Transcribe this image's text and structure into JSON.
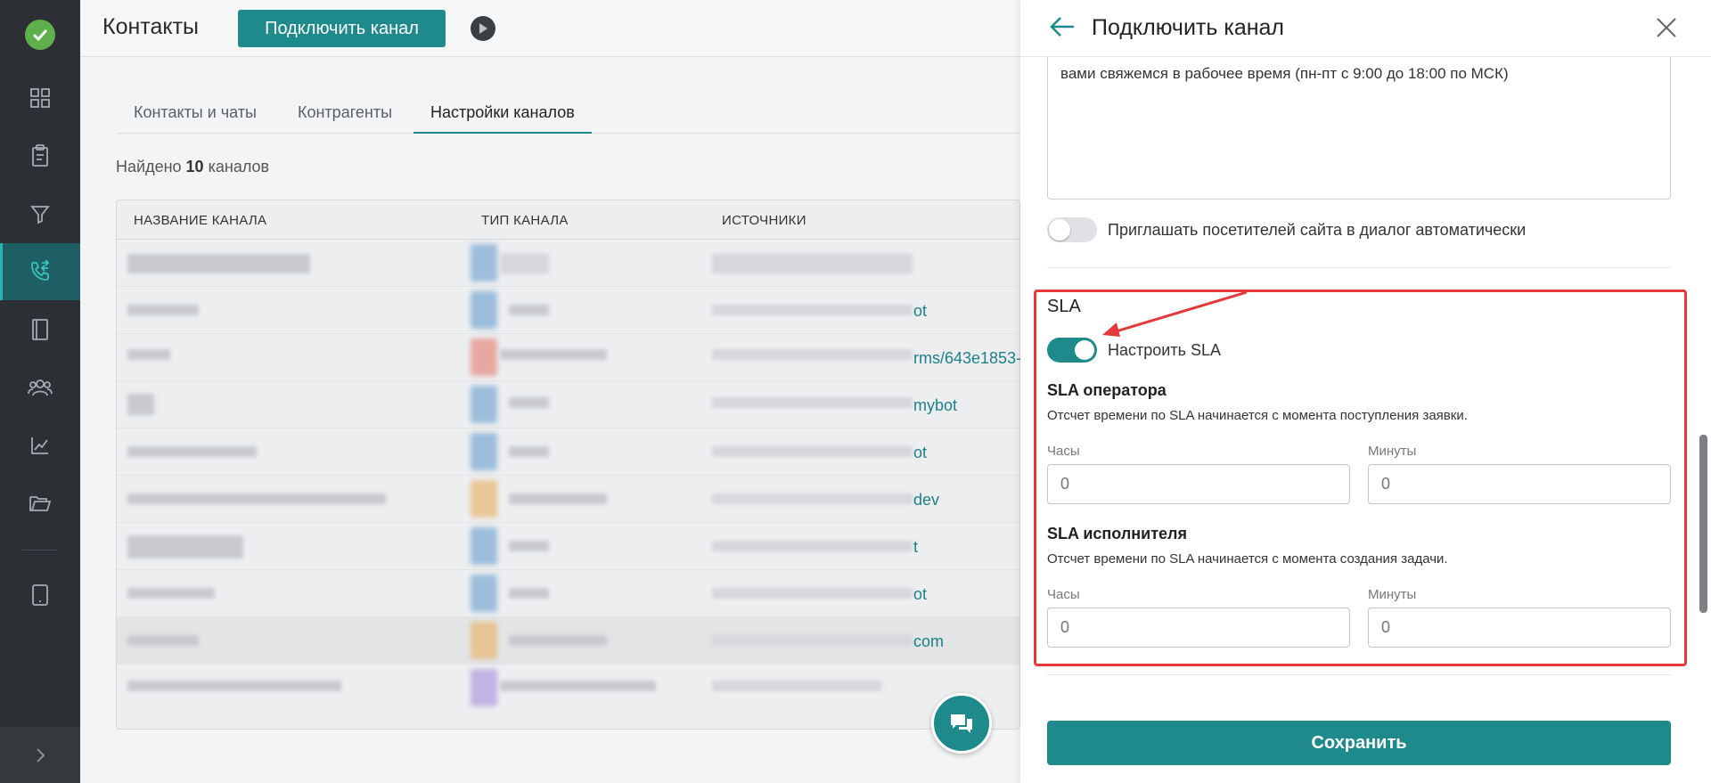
{
  "sidebar": {
    "items": [
      {
        "icon": "dashboard-grid-icon"
      },
      {
        "icon": "clipboard-icon"
      },
      {
        "icon": "funnel-icon"
      },
      {
        "icon": "phone-transfer-icon",
        "active": true
      },
      {
        "icon": "book-icon"
      },
      {
        "icon": "users-icon"
      },
      {
        "icon": "analytics-chart-icon"
      },
      {
        "icon": "folder-open-icon"
      },
      {
        "icon": "tablet-icon"
      }
    ],
    "expand_icon": "chevron-right-icon"
  },
  "header": {
    "title": "Контакты",
    "connect_button": "Подключить канал"
  },
  "tabs": [
    {
      "label": "Контакты и чаты"
    },
    {
      "label": "Контрагенты"
    },
    {
      "label": "Настройки каналов",
      "active": true
    }
  ],
  "found": {
    "prefix": "Найдено",
    "count": "10",
    "suffix": "каналов"
  },
  "table": {
    "columns": [
      "НАЗВАНИЕ КАНАЛА",
      "ТИП КАНАЛА",
      "ИСТОЧНИКИ"
    ],
    "rows": [
      {
        "source_suffix": ""
      },
      {
        "source_suffix": "ot"
      },
      {
        "source_suffix": "rms/643e1853-"
      },
      {
        "source_suffix": "mybot"
      },
      {
        "source_suffix": "ot"
      },
      {
        "source_suffix": "dev"
      },
      {
        "source_suffix": "t"
      },
      {
        "source_suffix": "ot"
      },
      {
        "source_suffix": "com"
      },
      {
        "source_suffix": ""
      }
    ]
  },
  "panel": {
    "title": "Подключить канал",
    "message_text": "вами свяжемся в рабочее время (пн-пт с 9:00 до 18:00 по МСК)",
    "invite_toggle": {
      "label": "Приглашать посетителей сайта в диалог автоматически",
      "on": false
    },
    "sla": {
      "title": "SLA",
      "toggle": {
        "label": "Настроить SLA",
        "on": true
      },
      "operator": {
        "title": "SLA оператора",
        "description": "Отсчет времени по SLA начинается с момента поступления заявки.",
        "hours_label": "Часы",
        "hours_placeholder": "0",
        "minutes_label": "Минуты",
        "minutes_placeholder": "0"
      },
      "executor": {
        "title": "SLA исполнителя",
        "description": "Отсчет времени по SLA начинается с момента создания задачи.",
        "hours_label": "Часы",
        "hours_placeholder": "0",
        "minutes_label": "Минуты",
        "minutes_placeholder": "0"
      }
    },
    "save_button": "Сохранить"
  },
  "colors": {
    "accent": "#1f8a8b",
    "sidebar": "#2c2f33",
    "highlight": "#e3393a"
  }
}
